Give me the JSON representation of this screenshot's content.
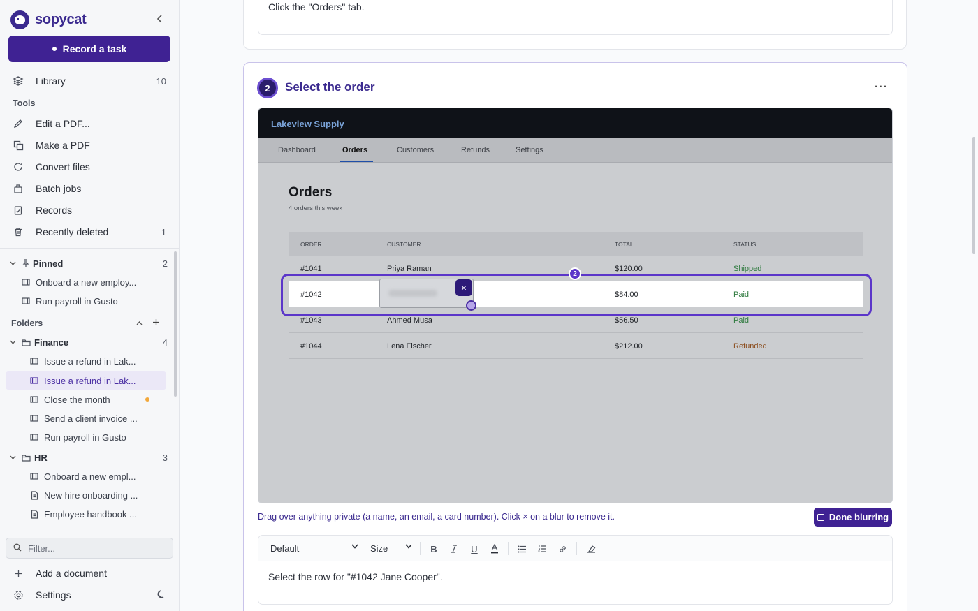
{
  "brand": {
    "name": "sopycat"
  },
  "sidebar": {
    "record_label": "Record a task",
    "library": {
      "label": "Library",
      "count": "10"
    },
    "tools_heading": "Tools",
    "tools": [
      {
        "label": "Edit a PDF...",
        "icon": "pencil-icon"
      },
      {
        "label": "Make a PDF",
        "icon": "copy-icon"
      },
      {
        "label": "Convert files",
        "icon": "refresh-icon"
      },
      {
        "label": "Batch jobs",
        "icon": "bag-icon"
      },
      {
        "label": "Records",
        "icon": "clipboard-check-icon"
      },
      {
        "label": "Recently deleted",
        "icon": "trash-icon",
        "count": "1"
      }
    ],
    "pinned": {
      "label": "Pinned",
      "count": "2",
      "items": [
        "Onboard a new employ...",
        "Run payroll in Gusto"
      ]
    },
    "folders_heading": "Folders",
    "finance": {
      "label": "Finance",
      "count": "4",
      "items": [
        "Issue a refund in Lak...",
        "Issue a refund in Lak...",
        "Close the month",
        "Send a client invoice ...",
        "Run payroll in Gusto"
      ]
    },
    "hr": {
      "label": "HR",
      "count": "3",
      "items": [
        "Onboard a new empl...",
        "New hire onboarding ...",
        "Employee handbook ..."
      ]
    },
    "filter_placeholder": "Filter...",
    "add_document": "Add a document",
    "settings": "Settings"
  },
  "previous_step": {
    "text": "Click the \"Orders\" tab."
  },
  "step": {
    "number": "2",
    "title": "Select the order",
    "more": "···"
  },
  "screenshot": {
    "brand": "Lakeview Supply",
    "tabs": [
      "Dashboard",
      "Orders",
      "Customers",
      "Refunds",
      "Settings"
    ],
    "active_tab": "Orders",
    "title": "Orders",
    "subtitle": "4 orders this week",
    "columns": [
      "ORDER",
      "CUSTOMER",
      "TOTAL",
      "STATUS"
    ],
    "rows": [
      {
        "order": "#1041",
        "customer": "Priya Raman",
        "total": "$120.00",
        "status": "Shipped"
      },
      {
        "order": "#1042",
        "customer": "",
        "total": "$84.00",
        "status": "Paid"
      },
      {
        "order": "#1043",
        "customer": "Ahmed Musa",
        "total": "$56.50",
        "status": "Paid"
      },
      {
        "order": "#1044",
        "customer": "Lena Fischer",
        "total": "$212.00",
        "status": "Refunded"
      }
    ],
    "selection_badge": "2",
    "blur_remove": "×"
  },
  "hint": "Drag over anything private (a name, an email, a card number). Click × on a blur to remove it.",
  "done_label": "Done blurring",
  "editor": {
    "font_select": "Default",
    "size_select": "Size",
    "text": "Select the row for \"#1042 Jane Cooper\"."
  },
  "colors": {
    "accent": "#3f2293",
    "highlight": "#5b36c9"
  }
}
